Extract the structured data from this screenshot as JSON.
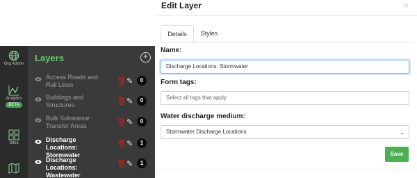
{
  "nav": {
    "items": [
      {
        "label": "Org Admin",
        "icon": "globe-icon"
      },
      {
        "label": "Analytics",
        "icon": "chart-line-icon",
        "badge": "BETA"
      },
      {
        "label": "Sites",
        "icon": "grid-icon"
      },
      {
        "label": "",
        "icon": "map-icon"
      }
    ]
  },
  "layers": {
    "title": "Layers",
    "add_icon": "plus-circle-icon",
    "items": [
      {
        "name": "Access Roads and Rail Lines",
        "count": "0",
        "active": false
      },
      {
        "name": "Buildings and Structures",
        "count": "0",
        "active": false
      },
      {
        "name": "Bulk Substance Transfer Areas",
        "count": "0",
        "active": false
      },
      {
        "name": "Discharge Locations: Stormwater",
        "count": "1",
        "active": true
      },
      {
        "name": "Discharge Locations: Wastewater",
        "count": "1",
        "active": true
      }
    ]
  },
  "modal": {
    "title": "Edit Layer",
    "close": "×",
    "tabs": [
      "Details",
      "Styles"
    ],
    "name_label": "Name:",
    "name_value": "Discharge Locations: Stormwater",
    "tags_label": "Form tags:",
    "tags_placeholder": "Select all tags that apply",
    "medium_label": "Water discharge medium:",
    "medium_value": "Stormwater Discharge Locations",
    "save_label": "Save"
  },
  "colors": {
    "accent_green": "#4caf50",
    "layers_title": "#6cc86f",
    "delete_red": "#b72424"
  }
}
